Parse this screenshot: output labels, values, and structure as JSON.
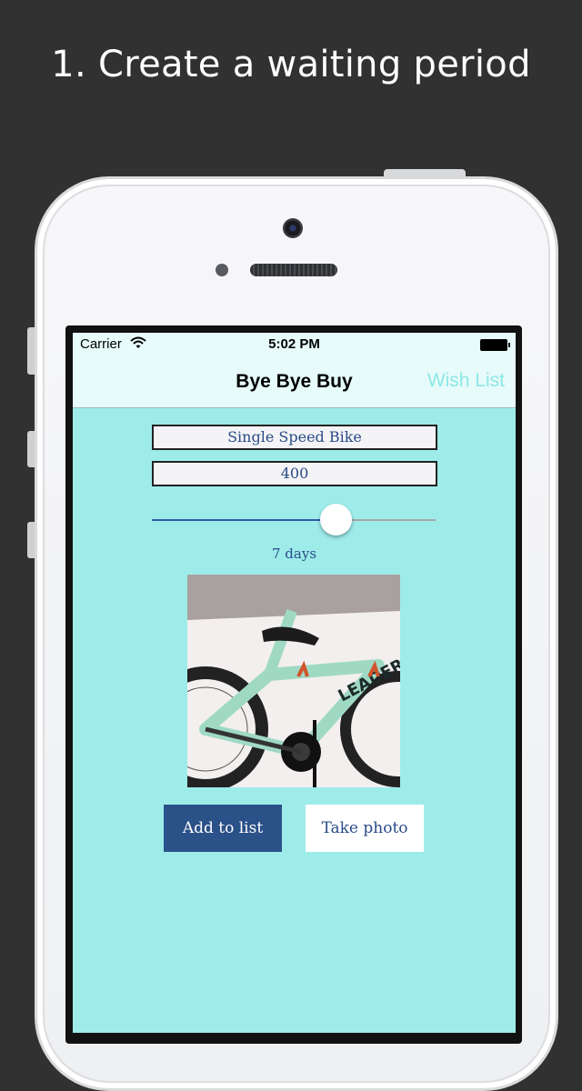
{
  "headline": "1. Create a waiting period",
  "status_bar": {
    "carrier": "Carrier",
    "time": "5:02 PM"
  },
  "nav": {
    "title": "Bye Bye Buy",
    "right_button": "Wish List"
  },
  "form": {
    "item_name": "Single Speed Bike",
    "price": "400",
    "waiting_days": 7,
    "slider_fraction": 0.65,
    "waiting_label": "7 days"
  },
  "buttons": {
    "add": "Add to list",
    "photo": "Take photo"
  },
  "icons": {
    "wifi": "wifi-icon",
    "battery": "battery-icon",
    "photo": "bike-photo"
  },
  "colors": {
    "screen_bg": "#9eecea",
    "nav_tint": "#8ee7e6",
    "primary": "#2b5189",
    "text": "#2a4b87"
  }
}
